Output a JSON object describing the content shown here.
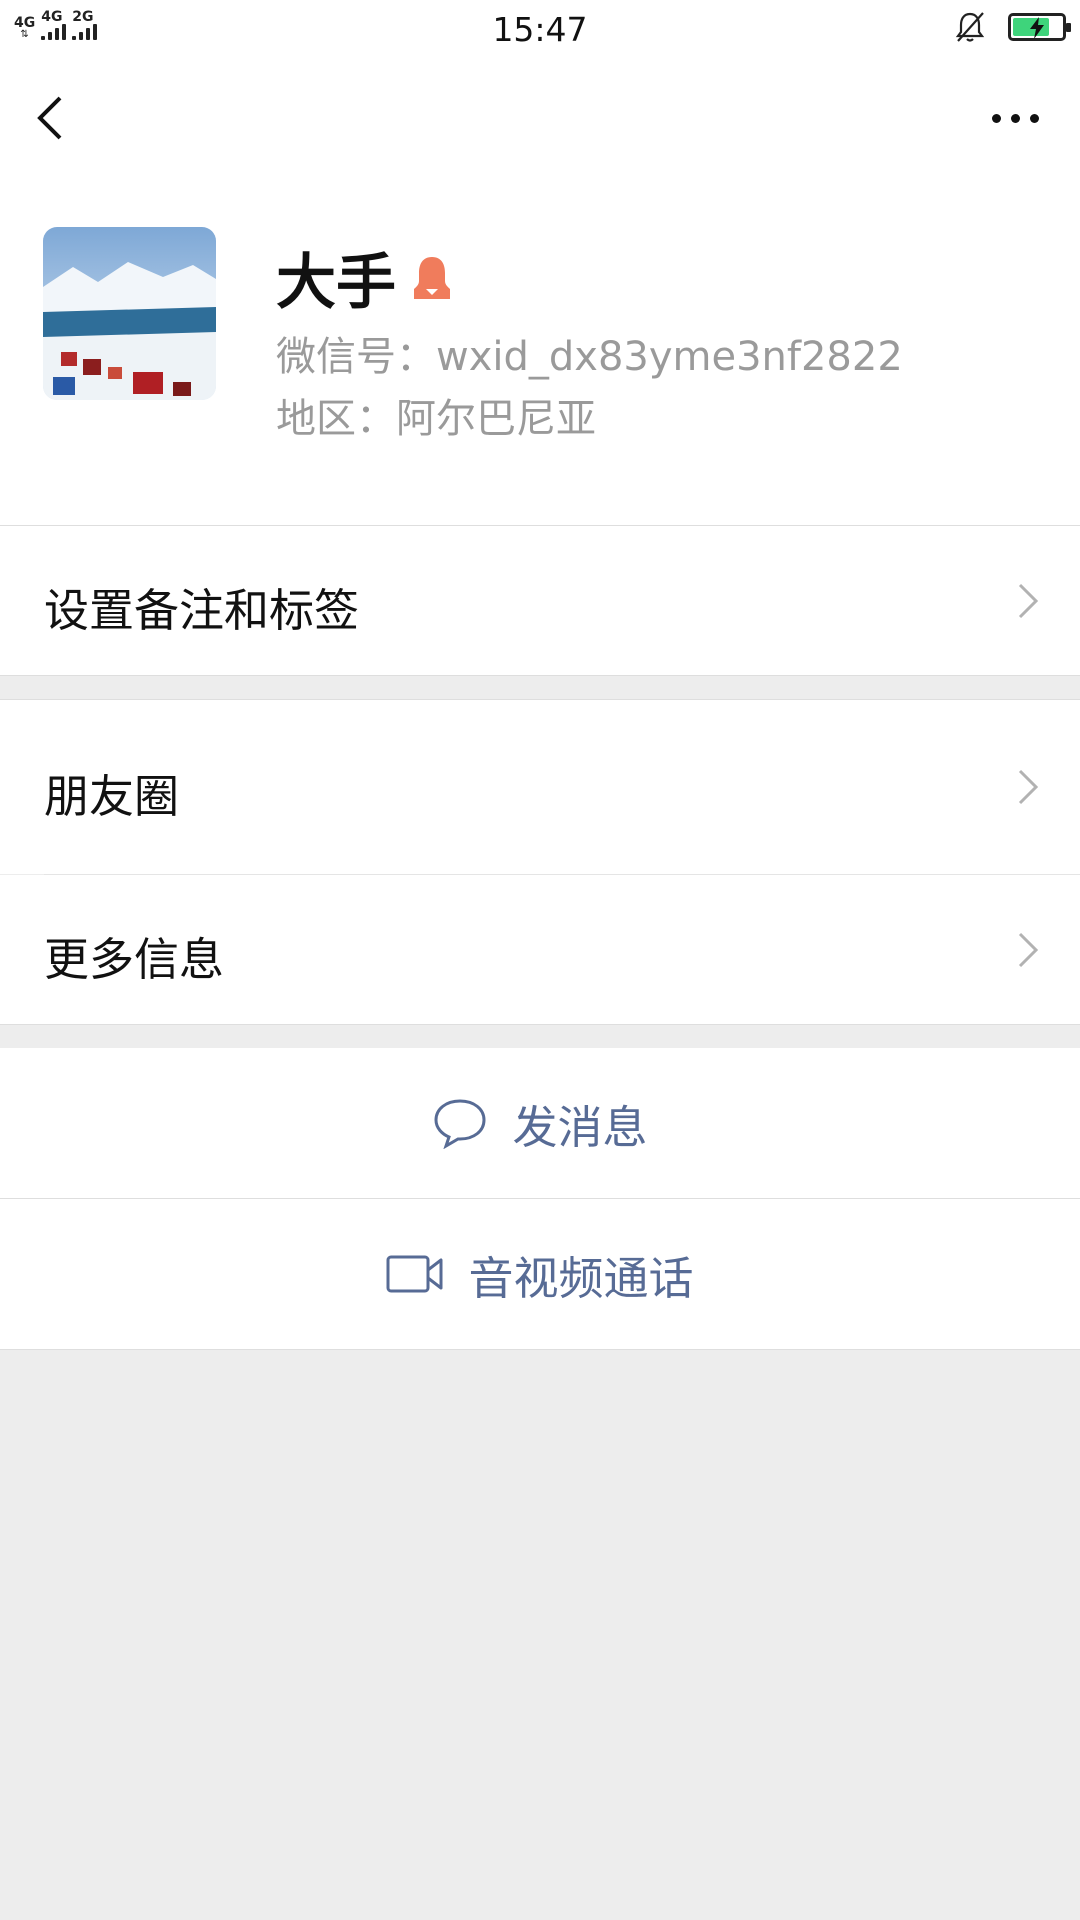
{
  "status_bar": {
    "network_1": "4G",
    "network_2": "4G",
    "network_3": "2G",
    "time": "15:47",
    "battery_percent": 70,
    "icons": [
      "signal-icon",
      "bell-muted-icon",
      "battery-charging-icon"
    ]
  },
  "header": {
    "back_icon": "chevron-left-icon",
    "more_icon": "more-dots-icon"
  },
  "profile": {
    "name": "大手",
    "gender_icon": "female-icon",
    "wechat_id": "微信号：wxid_dx83yme3nf2822",
    "region": "地区：阿尔巴尼亚"
  },
  "menu": {
    "remark_label": "设置备注和标签",
    "moments_label": "朋友圈",
    "more_info_label": "更多信息"
  },
  "actions": {
    "message_label": "发消息",
    "call_label": "音视频通话"
  },
  "colors": {
    "background": "#ededed",
    "link": "#576b95",
    "gender": "#f07c5c",
    "battery": "#3ed47b"
  }
}
